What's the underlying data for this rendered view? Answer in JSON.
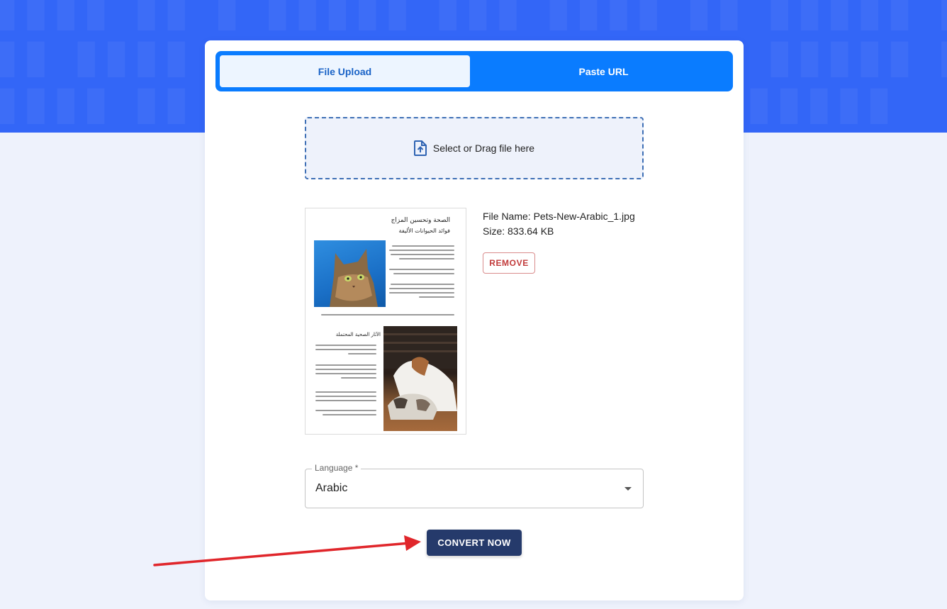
{
  "tabs": [
    {
      "label": "File Upload",
      "active": true
    },
    {
      "label": "Paste URL",
      "active": false
    }
  ],
  "dropzone": {
    "text": "Select or Drag file here",
    "icon": "file-upload-icon"
  },
  "preview": {
    "heading_1": "الصحة وتحسين المزاج",
    "heading_2": "فوائد الحيوانات الأليفة",
    "heading_3": "الآثار الصحية المحتملة"
  },
  "file": {
    "name_text": "File Name: Pets-New-Arabic_1.jpg",
    "size_text": "Size: 833.64 KB"
  },
  "remove_label": "REMOVE",
  "language": {
    "label": "Language *",
    "value": "Arabic"
  },
  "convert_label": "CONVERT NOW",
  "colors": {
    "hero": "#3366f7",
    "tab_bar": "#0a7cff",
    "active_tab_text": "#1a63c7",
    "convert_button": "#253a6b",
    "remove_text": "#c23b3b",
    "arrow": "#e0262b"
  }
}
